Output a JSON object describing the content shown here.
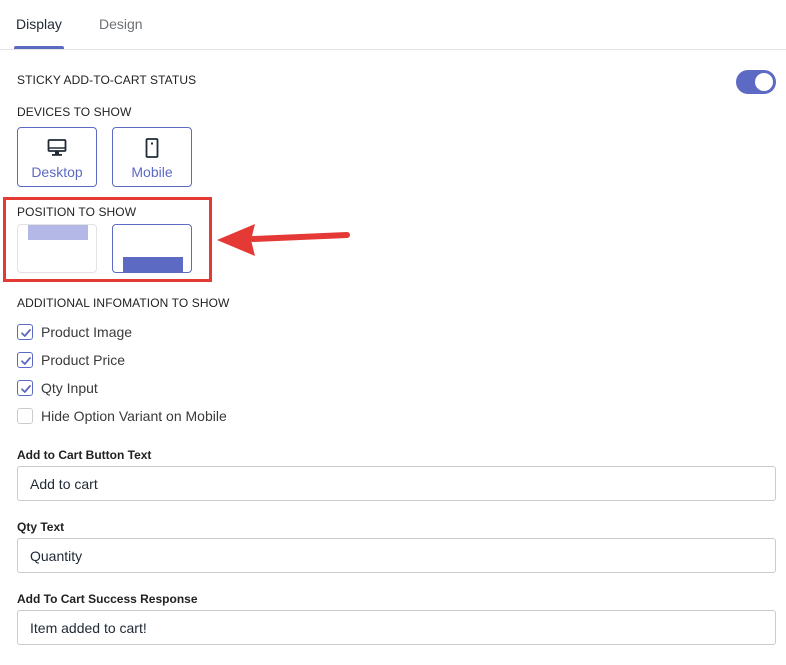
{
  "tabs": [
    {
      "label": "Display",
      "active": true
    },
    {
      "label": "Design",
      "active": false
    }
  ],
  "sticky_status": {
    "label": "STICKY ADD-TO-CART STATUS",
    "enabled": true
  },
  "devices": {
    "label": "DEVICES TO SHOW",
    "options": [
      {
        "label": "Desktop",
        "icon": "desktop-icon",
        "selected": true
      },
      {
        "label": "Mobile",
        "icon": "mobile-icon",
        "selected": true
      }
    ]
  },
  "position": {
    "label": "POSITION TO SHOW",
    "options": [
      {
        "value": "top",
        "selected": false
      },
      {
        "value": "bottom",
        "selected": true
      }
    ]
  },
  "additional": {
    "label": "ADDITIONAL INFOMATION TO SHOW",
    "items": [
      {
        "label": "Product Image",
        "checked": true
      },
      {
        "label": "Product Price",
        "checked": true
      },
      {
        "label": "Qty Input",
        "checked": true
      },
      {
        "label": "Hide Option Variant on Mobile",
        "checked": false
      }
    ]
  },
  "fields": [
    {
      "label": "Add to Cart Button Text",
      "value": "Add to cart"
    },
    {
      "label": "Qty Text",
      "value": "Quantity"
    },
    {
      "label": "Add To Cart Success Response",
      "value": "Item added to cart!"
    }
  ],
  "colors": {
    "accent": "#5c6ac4",
    "highlight": "#e53935"
  }
}
